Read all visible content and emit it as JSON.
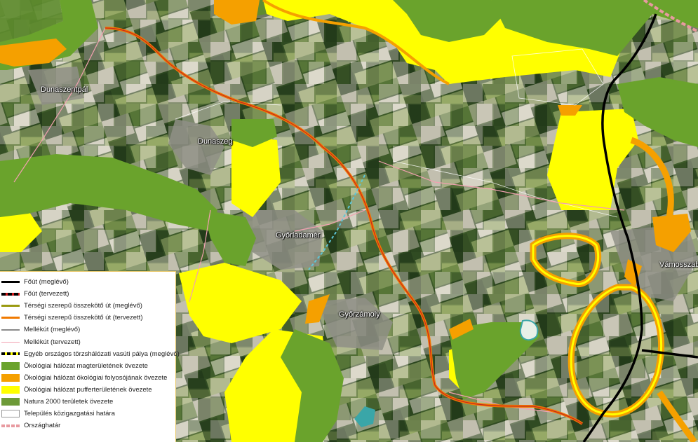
{
  "places": {
    "dunaszentpal": "Dunaszentpál",
    "dunaszeg": "Dunaszeg",
    "gyorladamer": "Győrladamér",
    "gyorzamoly": "Győrzámoly",
    "vamosszabadi": "Vámosszabadi"
  },
  "colors": {
    "core_green": "#6aa32c",
    "corridor_orange": "#f5a000",
    "buffer_yellow": "#ffff00",
    "natura_green": "#6d9a38",
    "main_road": "#000000",
    "regional_road": "#f07a00",
    "secondary_road_planned": "#f2a0b0",
    "country_border": "#e89aa0"
  },
  "legend": {
    "items": [
      {
        "label": "Főút (meglévő)",
        "icon": "solid-black-line"
      },
      {
        "label": "Főút (tervezett)",
        "icon": "dashed-black-red-line"
      },
      {
        "label": "Térségi szerepű összekötő út (meglévő)",
        "icon": "olive-line"
      },
      {
        "label": "Térségi szerepű összekötő út (tervezett)",
        "icon": "orange-line"
      },
      {
        "label": "Mellékút (meglévő)",
        "icon": "grey-line"
      },
      {
        "label": "Mellékút (tervezett)",
        "icon": "pink-line"
      },
      {
        "label": "Egyéb országos törzshálózati vasúti pálya (meglévő)",
        "icon": "railway-line"
      },
      {
        "label": "Ökológiai hálózat magterületének övezete",
        "icon": "green-fill"
      },
      {
        "label": "Ökológiai hálózat ökológiai folyosójának övezete",
        "icon": "orange-fill"
      },
      {
        "label": "Ökológiai hálózat pufferterületének övezete",
        "icon": "yellow-fill"
      },
      {
        "label": "Natura 2000 területek övezete",
        "icon": "dark-green-fill"
      },
      {
        "label": "Település közigazgatási határa",
        "icon": "outline-box"
      },
      {
        "label": "Országhatár",
        "icon": "border-line"
      }
    ]
  }
}
